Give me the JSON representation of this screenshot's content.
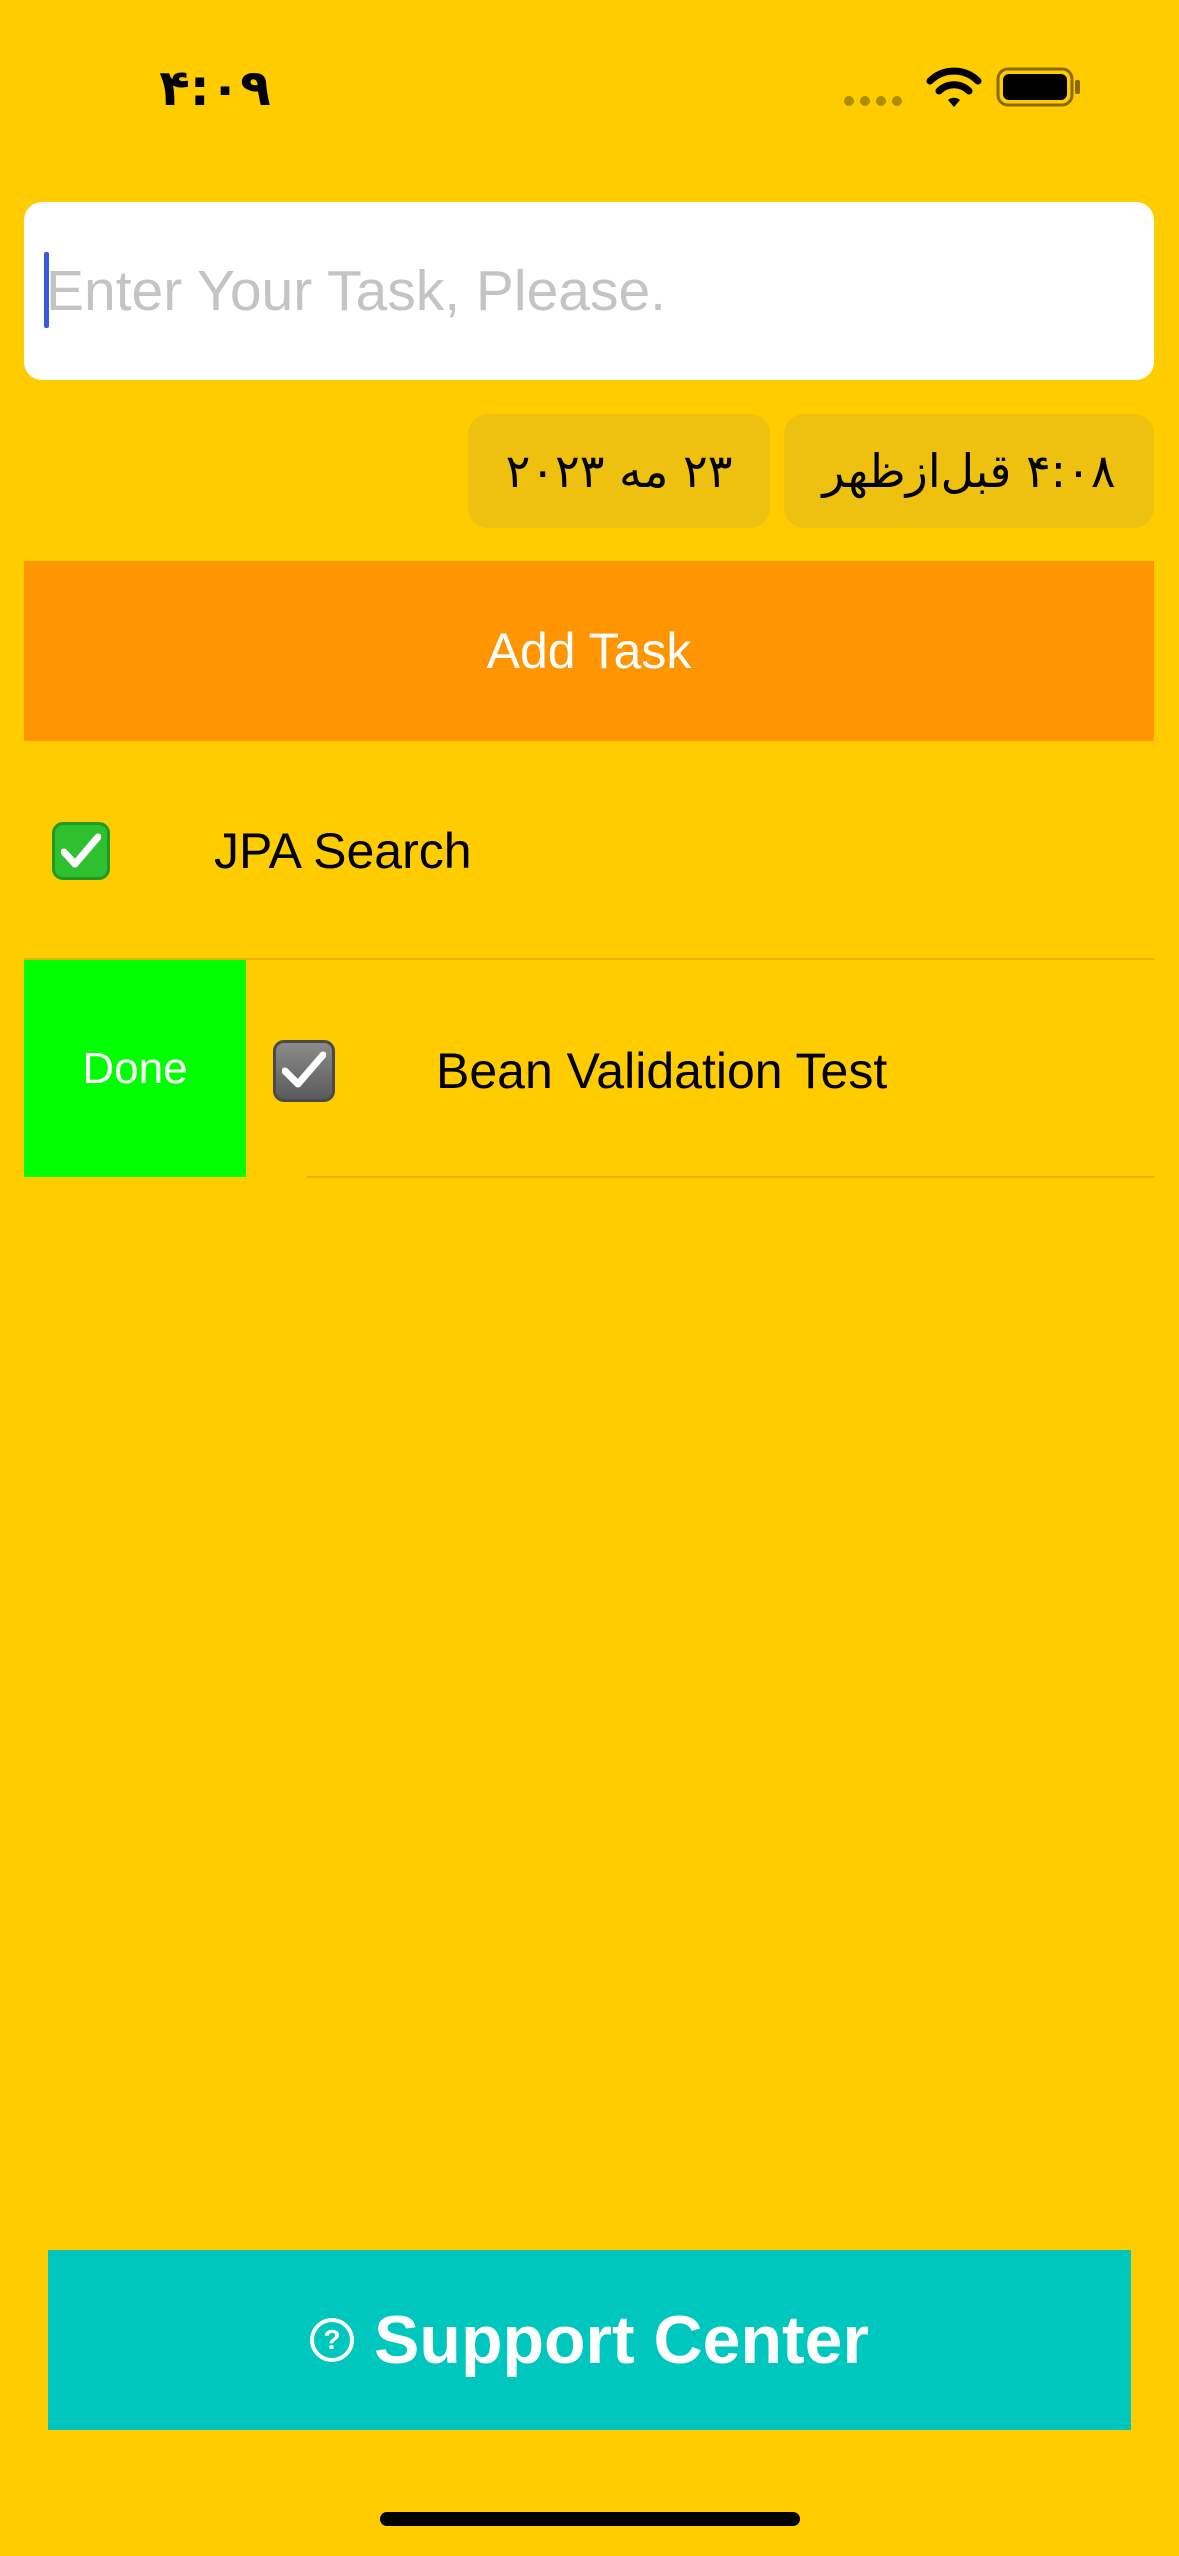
{
  "status_bar": {
    "time": "۴:۰۹",
    "icons": [
      "cellular-dots-icon",
      "wifi-icon",
      "battery-icon"
    ]
  },
  "task_input": {
    "placeholder": "Enter Your Task, Please.",
    "value": ""
  },
  "date_picker": {
    "date": "۲۳ مه ۲۰۲۳",
    "time": "۴:۰۸ قبل‌ازظهر"
  },
  "add_task": {
    "label": "Add Task"
  },
  "tasks": [
    {
      "title": "JPA Search",
      "done": true,
      "check_icon": "green-checkmark-icon"
    },
    {
      "title": "Bean Validation Test",
      "done": true,
      "check_icon": "gray-checkmark-icon",
      "swipe_action": "Done"
    }
  ],
  "support": {
    "label": "Support Center",
    "icon": "question-circle-icon"
  },
  "colors": {
    "background": "#FFCC00",
    "add_task_button": "#FF9500",
    "done_action": "#00FF00",
    "support_button": "#00C7BE",
    "chip_background": "#EEC010"
  }
}
